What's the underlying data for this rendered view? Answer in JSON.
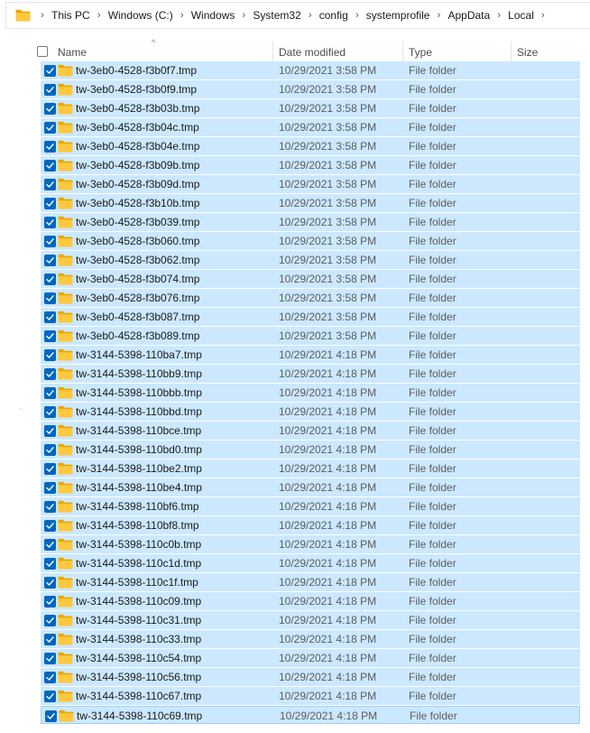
{
  "breadcrumb": [
    "This PC",
    "Windows (C:)",
    "Windows",
    "System32",
    "config",
    "systemprofile",
    "AppData",
    "Local"
  ],
  "columns": {
    "name": "Name",
    "date_modified": "Date modified",
    "type": "Type",
    "size": "Size"
  },
  "colors": {
    "selection": "#cce8ff",
    "checkbox": "#0067c0",
    "folder": "#ffc83d"
  },
  "files": [
    {
      "name": "tw-3eb0-4528-f3b0f7.tmp",
      "date": "10/29/2021 3:58 PM",
      "type": "File folder"
    },
    {
      "name": "tw-3eb0-4528-f3b0f9.tmp",
      "date": "10/29/2021 3:58 PM",
      "type": "File folder"
    },
    {
      "name": "tw-3eb0-4528-f3b03b.tmp",
      "date": "10/29/2021 3:58 PM",
      "type": "File folder"
    },
    {
      "name": "tw-3eb0-4528-f3b04c.tmp",
      "date": "10/29/2021 3:58 PM",
      "type": "File folder"
    },
    {
      "name": "tw-3eb0-4528-f3b04e.tmp",
      "date": "10/29/2021 3:58 PM",
      "type": "File folder"
    },
    {
      "name": "tw-3eb0-4528-f3b09b.tmp",
      "date": "10/29/2021 3:58 PM",
      "type": "File folder"
    },
    {
      "name": "tw-3eb0-4528-f3b09d.tmp",
      "date": "10/29/2021 3:58 PM",
      "type": "File folder"
    },
    {
      "name": "tw-3eb0-4528-f3b10b.tmp",
      "date": "10/29/2021 3:58 PM",
      "type": "File folder"
    },
    {
      "name": "tw-3eb0-4528-f3b039.tmp",
      "date": "10/29/2021 3:58 PM",
      "type": "File folder"
    },
    {
      "name": "tw-3eb0-4528-f3b060.tmp",
      "date": "10/29/2021 3:58 PM",
      "type": "File folder"
    },
    {
      "name": "tw-3eb0-4528-f3b062.tmp",
      "date": "10/29/2021 3:58 PM",
      "type": "File folder"
    },
    {
      "name": "tw-3eb0-4528-f3b074.tmp",
      "date": "10/29/2021 3:58 PM",
      "type": "File folder"
    },
    {
      "name": "tw-3eb0-4528-f3b076.tmp",
      "date": "10/29/2021 3:58 PM",
      "type": "File folder"
    },
    {
      "name": "tw-3eb0-4528-f3b087.tmp",
      "date": "10/29/2021 3:58 PM",
      "type": "File folder"
    },
    {
      "name": "tw-3eb0-4528-f3b089.tmp",
      "date": "10/29/2021 3:58 PM",
      "type": "File folder"
    },
    {
      "name": "tw-3144-5398-110ba7.tmp",
      "date": "10/29/2021 4:18 PM",
      "type": "File folder"
    },
    {
      "name": "tw-3144-5398-110bb9.tmp",
      "date": "10/29/2021 4:18 PM",
      "type": "File folder"
    },
    {
      "name": "tw-3144-5398-110bbb.tmp",
      "date": "10/29/2021 4:18 PM",
      "type": "File folder"
    },
    {
      "name": "tw-3144-5398-110bbd.tmp",
      "date": "10/29/2021 4:18 PM",
      "type": "File folder"
    },
    {
      "name": "tw-3144-5398-110bce.tmp",
      "date": "10/29/2021 4:18 PM",
      "type": "File folder"
    },
    {
      "name": "tw-3144-5398-110bd0.tmp",
      "date": "10/29/2021 4:18 PM",
      "type": "File folder"
    },
    {
      "name": "tw-3144-5398-110be2.tmp",
      "date": "10/29/2021 4:18 PM",
      "type": "File folder"
    },
    {
      "name": "tw-3144-5398-110be4.tmp",
      "date": "10/29/2021 4:18 PM",
      "type": "File folder"
    },
    {
      "name": "tw-3144-5398-110bf6.tmp",
      "date": "10/29/2021 4:18 PM",
      "type": "File folder"
    },
    {
      "name": "tw-3144-5398-110bf8.tmp",
      "date": "10/29/2021 4:18 PM",
      "type": "File folder"
    },
    {
      "name": "tw-3144-5398-110c0b.tmp",
      "date": "10/29/2021 4:18 PM",
      "type": "File folder"
    },
    {
      "name": "tw-3144-5398-110c1d.tmp",
      "date": "10/29/2021 4:18 PM",
      "type": "File folder"
    },
    {
      "name": "tw-3144-5398-110c1f.tmp",
      "date": "10/29/2021 4:18 PM",
      "type": "File folder"
    },
    {
      "name": "tw-3144-5398-110c09.tmp",
      "date": "10/29/2021 4:18 PM",
      "type": "File folder"
    },
    {
      "name": "tw-3144-5398-110c31.tmp",
      "date": "10/29/2021 4:18 PM",
      "type": "File folder"
    },
    {
      "name": "tw-3144-5398-110c33.tmp",
      "date": "10/29/2021 4:18 PM",
      "type": "File folder"
    },
    {
      "name": "tw-3144-5398-110c54.tmp",
      "date": "10/29/2021 4:18 PM",
      "type": "File folder"
    },
    {
      "name": "tw-3144-5398-110c56.tmp",
      "date": "10/29/2021 4:18 PM",
      "type": "File folder"
    },
    {
      "name": "tw-3144-5398-110c67.tmp",
      "date": "10/29/2021 4:18 PM",
      "type": "File folder"
    },
    {
      "name": "tw-3144-5398-110c69.tmp",
      "date": "10/29/2021 4:18 PM",
      "type": "File folder"
    }
  ]
}
